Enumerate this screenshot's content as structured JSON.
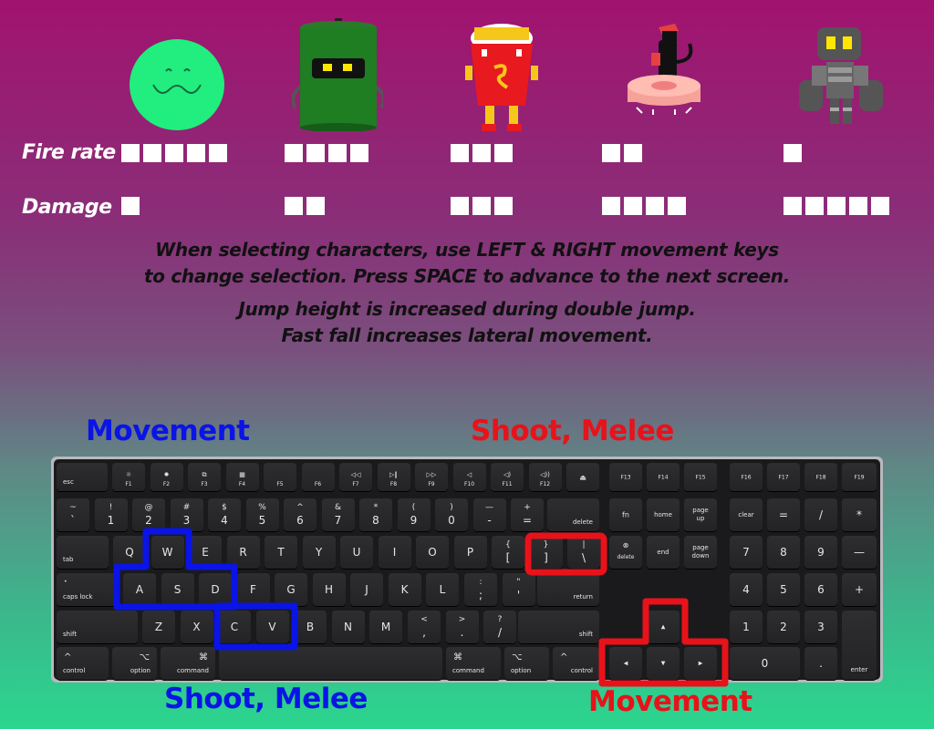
{
  "characters": [
    {
      "name": "slime",
      "fire_rate": 5,
      "damage": 1
    },
    {
      "name": "trash-can-robot",
      "fire_rate": 4,
      "damage": 2
    },
    {
      "name": "fries",
      "fire_rate": 3,
      "damage": 3
    },
    {
      "name": "cat-on-robot-vacuum",
      "fire_rate": 2,
      "damage": 4
    },
    {
      "name": "grey-robot",
      "fire_rate": 1,
      "damage": 5
    }
  ],
  "stats": {
    "fire_rate_label": "Fire rate",
    "damage_label": "Damage"
  },
  "instructions": {
    "line1": "When selecting characters, use LEFT & RIGHT movement keys",
    "line2": "to change selection. Press SPACE to advance to the next screen.",
    "line3": "Jump height is increased during double jump.",
    "line4": "Fast fall increases lateral movement."
  },
  "callouts": {
    "p1_movement": "Movement",
    "p1_shoot": "Shoot, Melee",
    "p2_shoot": "Shoot, Melee",
    "p2_movement": "Movement"
  },
  "colors": {
    "player1": "#0a14e6",
    "player2": "#e8121a",
    "bar": "#ffffff"
  },
  "keyboard": {
    "fn_row": [
      {
        "icon": "☼",
        "label": "F1"
      },
      {
        "icon": "✹",
        "label": "F2"
      },
      {
        "icon": "⧉",
        "label": "F3"
      },
      {
        "icon": "▦",
        "label": "F4"
      },
      {
        "icon": "",
        "label": "F5"
      },
      {
        "icon": "",
        "label": "F6"
      },
      {
        "icon": "◁◁",
        "label": "F7"
      },
      {
        "icon": "▷‖",
        "label": "F8"
      },
      {
        "icon": "▷▷",
        "label": "F9"
      },
      {
        "icon": "◁",
        "label": "F10"
      },
      {
        "icon": "◁)",
        "label": "F11"
      },
      {
        "icon": "◁))",
        "label": "F12"
      }
    ],
    "esc": "esc",
    "eject": "⏏",
    "fn_row2": [
      "F13",
      "F14",
      "F15"
    ],
    "fn_row3": [
      "F16",
      "F17",
      "F18",
      "F19"
    ],
    "num_row": [
      {
        "t": "~",
        "b": "`"
      },
      {
        "t": "!",
        "b": "1"
      },
      {
        "t": "@",
        "b": "2"
      },
      {
        "t": "#",
        "b": "3"
      },
      {
        "t": "$",
        "b": "4"
      },
      {
        "t": "%",
        "b": "5"
      },
      {
        "t": "^",
        "b": "6"
      },
      {
        "t": "&",
        "b": "7"
      },
      {
        "t": "*",
        "b": "8"
      },
      {
        "t": "(",
        "b": "9"
      },
      {
        "t": ")",
        "b": "0"
      },
      {
        "t": "—",
        "b": "-"
      },
      {
        "t": "+",
        "b": "="
      }
    ],
    "delete": "delete",
    "nav1": [
      {
        "label": "fn"
      },
      {
        "label": "home"
      },
      {
        "label": "page up"
      }
    ],
    "num1": [
      "clear",
      "=",
      "/",
      "*"
    ],
    "tab": "tab",
    "q_row": [
      "Q",
      "W",
      "E",
      "R",
      "T",
      "Y",
      "U",
      "I",
      "O",
      "P"
    ],
    "q_row_sym": [
      {
        "t": "{",
        "b": "["
      },
      {
        "t": "}",
        "b": "]"
      },
      {
        "t": "|",
        "b": "\\"
      }
    ],
    "nav2": [
      {
        "label": "delete",
        "icon": "⊗"
      },
      {
        "label": "end"
      },
      {
        "label": "page down"
      }
    ],
    "num2": [
      "7",
      "8",
      "9",
      "—"
    ],
    "caps": "caps lock",
    "a_row": [
      "A",
      "S",
      "D",
      "F",
      "G",
      "H",
      "J",
      "K",
      "L"
    ],
    "a_row_sym": [
      {
        "t": ":",
        "b": ";"
      },
      {
        "t": "\"",
        "b": "'"
      }
    ],
    "return": "return",
    "num3": [
      "4",
      "5",
      "6",
      "+"
    ],
    "shift": "shift",
    "z_row": [
      "Z",
      "X",
      "C",
      "V",
      "B",
      "N",
      "M"
    ],
    "z_row_sym": [
      {
        "t": "<",
        "b": ","
      },
      {
        "t": ">",
        "b": "."
      },
      {
        "t": "?",
        "b": "/"
      }
    ],
    "num4": [
      "1",
      "2",
      "3"
    ],
    "arrows": {
      "up": "▲",
      "left": "◀",
      "down": "▼",
      "right": "▶"
    },
    "bottom": {
      "control": "control",
      "option": "option",
      "command": "command"
    },
    "num5": [
      "0",
      "."
    ],
    "enter": "enter",
    "mod_icons": {
      "control": "^",
      "option": "⌥",
      "command": "⌘"
    }
  }
}
